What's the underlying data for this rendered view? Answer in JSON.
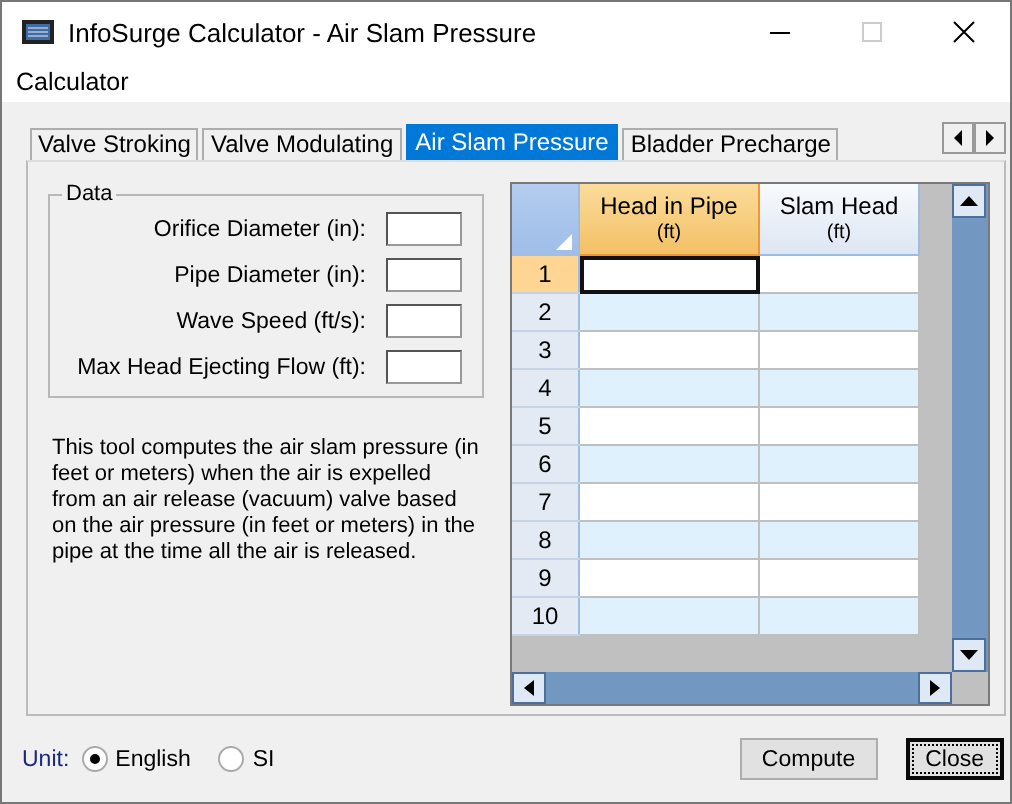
{
  "window": {
    "title": "InfoSurge Calculator - Air Slam Pressure"
  },
  "menu": [
    {
      "label": "Calculator"
    }
  ],
  "tabs": [
    {
      "label": "Valve Stroking",
      "selected": false
    },
    {
      "label": "Valve Modulating",
      "selected": false
    },
    {
      "label": "Air Slam Pressure",
      "selected": true
    },
    {
      "label": "Bladder Precharge",
      "selected": false
    }
  ],
  "data_group": {
    "title": "Data",
    "fields": [
      {
        "label": "Orifice Diameter (in):"
      },
      {
        "label": "Pipe Diameter (in):"
      },
      {
        "label": "Wave Speed (ft/s):"
      },
      {
        "label": "Max Head Ejecting Flow (ft):"
      }
    ]
  },
  "description": "This tool computes the air slam pressure (in feet or meters) when the air is expelled from an air release (vacuum) valve based on the air pressure (in feet or meters) in the pipe at the time all the air is released.",
  "grid": {
    "columns": [
      {
        "label": "Head in Pipe",
        "unit": "(ft)",
        "selected": true
      },
      {
        "label": "Slam Head",
        "unit": "(ft)",
        "selected": false
      }
    ],
    "rows": [
      {
        "label": "1",
        "selected": true
      },
      {
        "label": "2",
        "selected": false
      },
      {
        "label": "3",
        "selected": false
      },
      {
        "label": "4",
        "selected": false
      },
      {
        "label": "5",
        "selected": false
      },
      {
        "label": "6",
        "selected": false
      },
      {
        "label": "7",
        "selected": false
      },
      {
        "label": "8",
        "selected": false
      },
      {
        "label": "9",
        "selected": false
      },
      {
        "label": "10",
        "selected": false
      }
    ]
  },
  "unit": {
    "label": "Unit:",
    "options": [
      {
        "label": "English",
        "selected": true
      },
      {
        "label": "SI",
        "selected": false
      }
    ]
  },
  "buttons": [
    {
      "label": "Compute",
      "focused": false
    },
    {
      "label": "Close",
      "focused": true
    }
  ]
}
